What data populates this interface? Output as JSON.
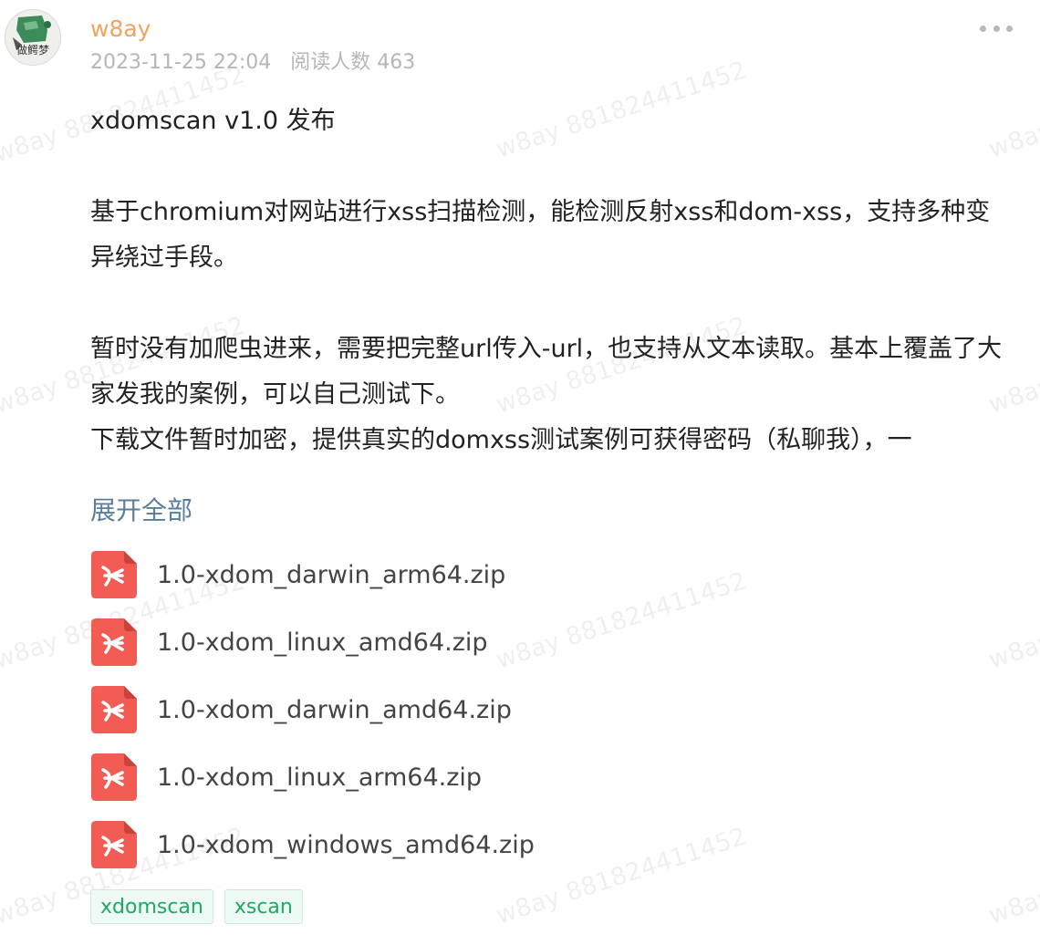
{
  "post": {
    "author": "w8ay",
    "datetime": "2023-11-25 22:04",
    "read_count": "阅读人数 463",
    "avatar_text": "做鳄梦"
  },
  "watermark_text": "w8ay 881824411452",
  "content": {
    "title": "xdomscan v1.0 发布",
    "para1": "基于chromium对网站进行xss扫描检测，能检测反射xss和dom-xss，支持多种变异绕过手段。",
    "para2_line1": "暂时没有加爬虫进来，需要把完整url传入-url，也支持从文本读取。基本上覆盖了大家发我的案例，可以自己测试下。",
    "para2_line2": "下载文件暂时加密，提供真实的domxss测试案例可获得密码（私聊我），一"
  },
  "expand_label": "展开全部",
  "files": [
    {
      "name": "1.0-xdom_darwin_arm64.zip",
      "icon": "pdf-file-icon"
    },
    {
      "name": "1.0-xdom_linux_amd64.zip",
      "icon": "pdf-file-icon"
    },
    {
      "name": "1.0-xdom_darwin_amd64.zip",
      "icon": "pdf-file-icon"
    },
    {
      "name": "1.0-xdom_linux_arm64.zip",
      "icon": "pdf-file-icon"
    },
    {
      "name": "1.0-xdom_windows_amd64.zip",
      "icon": "pdf-file-icon"
    }
  ],
  "tags": [
    "xdomscan",
    "xscan"
  ],
  "colors": {
    "author": "#f3a35d",
    "link": "#5b7d9c",
    "file_icon": "#f25c54",
    "tag_text": "#1fa866"
  }
}
